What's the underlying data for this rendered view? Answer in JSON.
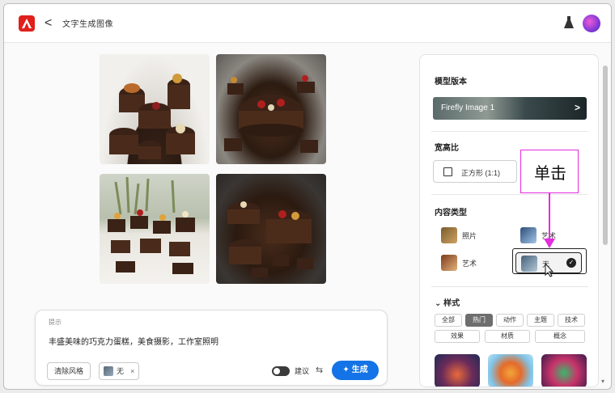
{
  "app": {
    "title": "文字生成图像",
    "back_label": "<",
    "logo_icon": "adobe-logo-icon",
    "accent_color": "#1473e6",
    "brand_color": "#e0201b"
  },
  "prompt": {
    "label": "提示",
    "text": "丰盛美味的巧克力蛋糕，美食摄影，工作室照明",
    "clear_label": "清除风格",
    "chip_label": "无",
    "chip_close": "×",
    "toggle_label": "建议",
    "generate_label": "生成"
  },
  "panel": {
    "model_title": "模型版本",
    "model_name": "Firefly Image 1",
    "model_arrow": ">",
    "ratio_title": "宽高比",
    "ratio_value": "正方形 (1:1)",
    "content_title": "内容类型",
    "content_types": [
      {
        "label": "照片"
      },
      {
        "label": "艺术"
      },
      {
        "label": "艺术"
      },
      {
        "label": "无"
      }
    ],
    "style_title": "样式",
    "style_chevron": "⌄",
    "style_tags": [
      "全部",
      "热门",
      "动作",
      "主题",
      "技术",
      "效果",
      "材质",
      "概念"
    ]
  },
  "annotation": {
    "text": "单击",
    "color": "#e52ce0"
  }
}
